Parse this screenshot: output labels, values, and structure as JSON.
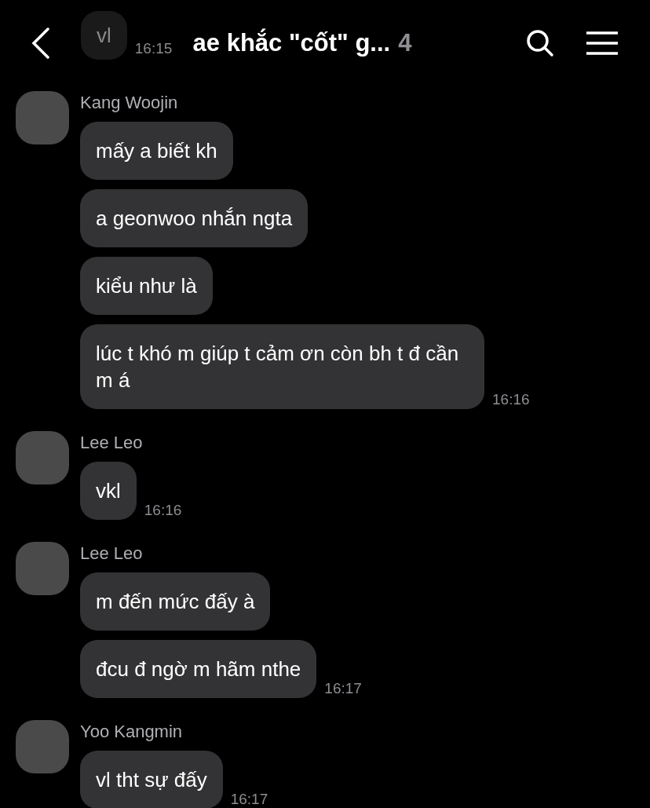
{
  "header": {
    "title": "ae khắc \"cốt\" g...",
    "member_count": "4"
  },
  "faded_message": {
    "text": "vl",
    "time": "16:15"
  },
  "groups": [
    {
      "sender": "Kang Woojin",
      "messages": [
        "mấy a biết kh",
        "a geonwoo nhắn ngta",
        "kiểu như là",
        "lúc t khó m giúp t cảm ơn còn bh t đ cần m á"
      ],
      "time": "16:16"
    },
    {
      "sender": "Lee Leo",
      "messages": [
        "vkl"
      ],
      "time": "16:16"
    },
    {
      "sender": "Lee Leo",
      "messages": [
        "m đến mức đấy à",
        "đcu đ ngờ m hãm nthe"
      ],
      "time": "16:17"
    },
    {
      "sender": "Yoo Kangmin",
      "messages": [
        "vl tht sự đấy"
      ],
      "time": "16:17"
    }
  ]
}
